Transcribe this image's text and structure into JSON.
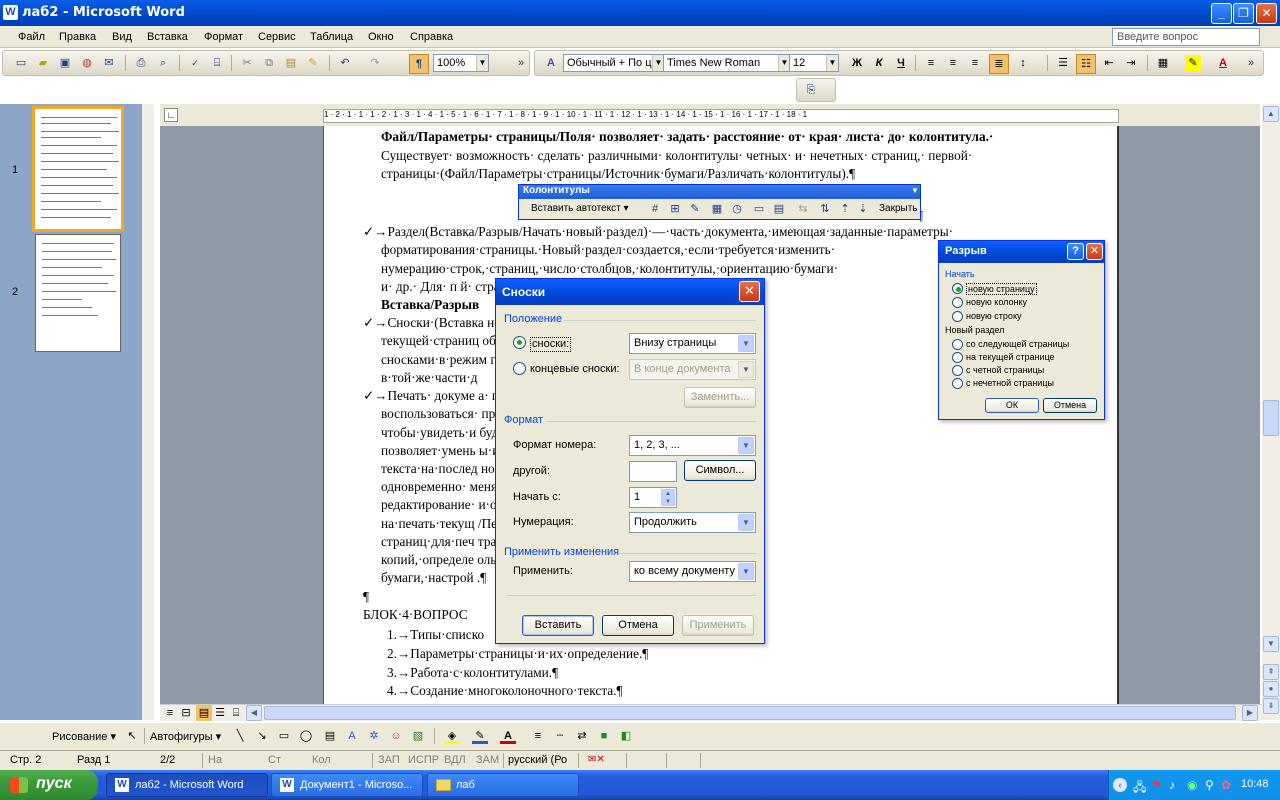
{
  "window": {
    "title": "лаб2 - Microsoft Word"
  },
  "menu": [
    "Файл",
    "Правка",
    "Вид",
    "Вставка",
    "Формат",
    "Сервис",
    "Таблица",
    "Окно",
    "Справка"
  ],
  "help_placeholder": "Введите вопрос",
  "format_toolbar": {
    "zoom": "100%",
    "style": "Обычный + По ц",
    "font": "Times New Roman",
    "size": "12",
    "bold": "Ж",
    "italic": "К",
    "underline": "Ч"
  },
  "thumbnails": [
    {
      "label": "1"
    },
    {
      "label": "2"
    }
  ],
  "ruler": "1 · 2 · 1 · 1 · 1 · 2 · 1 · 3 · 1 · 4 · 1 · 5 · 1 · 6 · 1 · 7 · 1 · 8 · 1 · 9 · 1 · 10 · 1 · 11 · 1 · 12 · 1 · 13 · 1 · 14 · 1 · 15 · 1 · 16 · 1 · 17 · 1 · 18 · 1",
  "doc_lines": [
    "Файл/Параметры· страницы/Поля· позволяет· задать· расстояние· от· края· листа· до· колонтитула.·",
    "Существует· возможность· сделать· различными· колонтитулы· четных· и· нечетных· страниц,· первой·",
    "страницы·(Файл/Параметры·страницы/Источник·бумаги/Различать·колонтитулы).¶",
    "¶",
    "✓→Раздел(Вставка/Разрыв/Начать·новый·раздел)·—·часть·документа,·имеющая·заданные·параметры·",
    "форматирования·страницы.·Новый·раздел·создается,·если·требуется·изменить·",
    "нумерацию·строк,·страниц,·число·столбцов,·колонтитулы,·ориентацию·бумаги·",
    "и·  др.·  Для·   п                                    й·  странице·  команда·",
    "Вставка/Разрыв",
    "✓→Сноски·(Вставка                                          но·располагать·в·конце·",
    "текущей·страниц                                             обнее·всего·работать·со·",
    "сносками·в·режим                                            гда·они·располагаются·",
    "в·той·же·части·д",
    "✓→Печать· докуме                                            а·  печать·  желательно·",
    "воспользоваться·                                          просмотр·  для·  того,·",
    "чтобы·увидеть·и                                           будет·напечатана.·Кнопка·Подгонка·страниц·",
    "позволяет·умень                                           ы·избежать·попадания·небольшого·фрагмента·",
    "текста·на·послед                                          ного·просмотра·можно·указывать·количество·",
    "одновременно·                                             менять·  масштаб·  изображения,·  выполнять·",
    "редактирование·                                           и·отжатой·кнопке·Увеличение).·Для·вывода·",
    "на·печать·текущ                                           /Печать.·Представляется·возможным·выбор·",
    "страниц·для·печ                                           траниц,·четные/нечетные),·задание·количества·",
    "копий,·определе                                           ольких·страниц·документа·на·одном·листе·",
    "бумаги,·настрой                                           .¶",
    "¶",
    "БЛОК·4·ВОПРОС",
    "1.→Типы·списко",
    "2.→Параметры·страницы·и·их·определение.¶",
    "3.→Работа·с·колонтитулами.¶",
    "4.→Создание·многоколоночного·текста.¶"
  ],
  "headers_toolbar": {
    "title": "Колонтитулы",
    "autotext": "Вставить автотекст ▾",
    "close": "Закрыть"
  },
  "footnotes_dialog": {
    "title": "Сноски",
    "group_position": "Положение",
    "footnotes_label": "сноски:",
    "footnotes_value": "Внизу страницы",
    "endnotes_label": "концевые сноски:",
    "endnotes_value": "В конце документа",
    "replace_button": "Заменить...",
    "group_format": "Формат",
    "number_format_label": "Формат номера:",
    "number_format_value": "1, 2, 3, ...",
    "custom_label": "другой:",
    "symbol_button": "Символ...",
    "start_label": "Начать с:",
    "start_value": "1",
    "numbering_label": "Нумерация:",
    "numbering_value": "Продолжить",
    "group_apply": "Применить изменения",
    "apply_label": "Применить:",
    "apply_value": "ко всему документу",
    "insert_button": "Вставить",
    "cancel_button": "Отмена",
    "apply_button": "Применить"
  },
  "break_dialog": {
    "title": "Разрыв",
    "group_begin": "Начать",
    "opt_page": "новую страницу",
    "opt_column": "новую колонку",
    "opt_line": "новую строку",
    "group_section": "Новый раздел",
    "opt_next": "со следующей страницы",
    "opt_current": "на текущей странице",
    "opt_even": "с четной страницы",
    "opt_odd": "с нечетной страницы",
    "ok_button": "ОК",
    "cancel_button": "Отмена"
  },
  "drawing_toolbar": {
    "draw": "Рисование ▾",
    "autoshapes": "Автофигуры ▾"
  },
  "status": {
    "page": "Стр. 2",
    "section": "Разд 1",
    "pages": "2/2",
    "at": "На",
    "line": "Ст",
    "col": "Кол",
    "rec": "ЗАП",
    "trk": "ИСПР",
    "ext": "ВДЛ",
    "ovr": "ЗАМ",
    "lang": "русский (Ро"
  },
  "taskbar": {
    "start": "пуск",
    "tasks": [
      "лаб2 - Microsoft Word",
      "Документ1 - Microso...",
      "лаб"
    ],
    "clock": "10:48"
  }
}
